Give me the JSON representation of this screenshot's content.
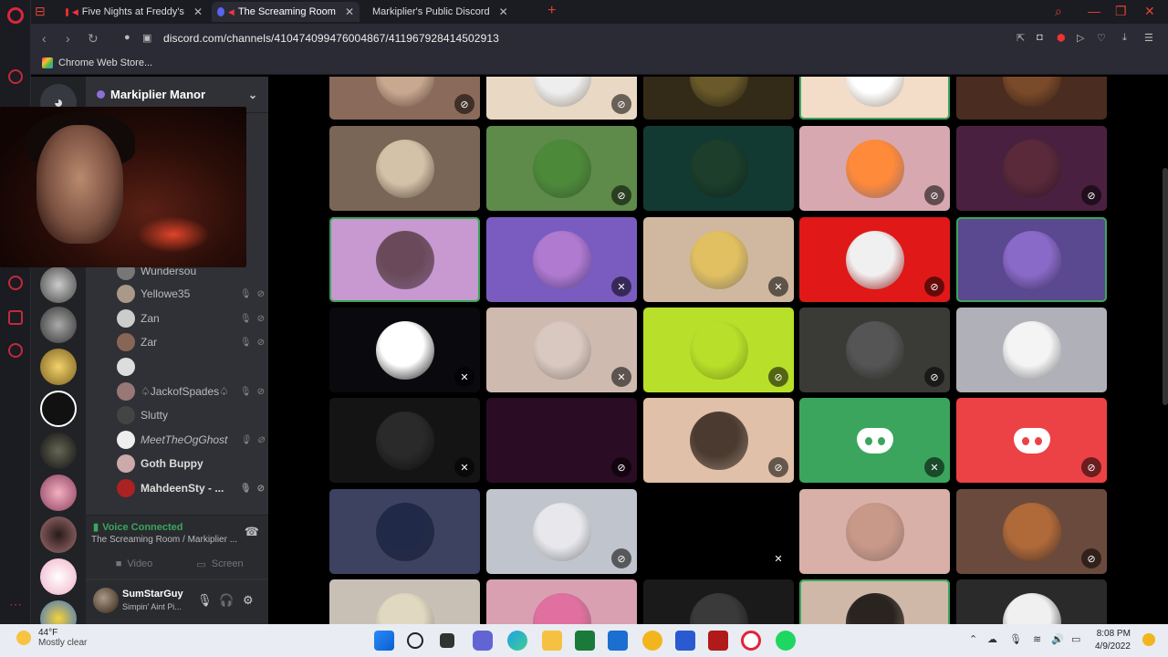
{
  "browser": {
    "tabs": [
      {
        "title": "Five Nights at Freddy's"
      },
      {
        "title": "The Screaming Room",
        "active": true
      },
      {
        "title": "Markiplier's Public Discord"
      }
    ],
    "url": "discord.com/channels/410474099476004867/411967928414502913",
    "bookmark": "Chrome Web Store..."
  },
  "discord": {
    "server_name": "Markiplier Manor",
    "voice_users": [
      {
        "name": "Wundersou"
      },
      {
        "name": "Yellowe35"
      },
      {
        "name": "Zan"
      },
      {
        "name": "Zar"
      },
      {
        "name": ""
      },
      {
        "name": "♤JackofSpades♤"
      },
      {
        "name": "Slutty"
      },
      {
        "name": "MeetTheOgGhost"
      },
      {
        "name": "Goth Buppy"
      },
      {
        "name": "MahdeenSty - ..."
      }
    ],
    "voice_panel": {
      "status": "Voice Connected",
      "channel": "The Screaming Room / Markiplier ...",
      "video_label": "Video",
      "screen_label": "Screen"
    },
    "user": {
      "name": "SumStarGuy",
      "status": "Simpin' Aint Pi..."
    }
  },
  "grid": {
    "tiles": [
      {
        "bg": "#8a6a5a",
        "av": "#c9a890",
        "st": "deaf"
      },
      {
        "bg": "#e8d8c4",
        "av": "#eee",
        "st": "deaf"
      },
      {
        "bg": "#332a18",
        "av": "#6a5a2a",
        "st": ""
      },
      {
        "bg": "#f3dcc8",
        "av": "#fff",
        "st": "",
        "speaking": true
      },
      {
        "bg": "#4a2c20",
        "av": "#7a4a2a",
        "st": ""
      },
      {
        "bg": "#7a6656",
        "av": "#d4c2a8",
        "st": ""
      },
      {
        "bg": "#5e8a4a",
        "av": "#4c8a3a",
        "st": "deaf"
      },
      {
        "bg": "#123a32",
        "av": "#1c3e2a",
        "st": ""
      },
      {
        "bg": "#d8a8b0",
        "av": "#ff8a3a",
        "st": "deaf"
      },
      {
        "bg": "#4a2040",
        "av": "#5a2a3a",
        "st": "deaf"
      },
      {
        "bg": "#c898d0",
        "av": "#6a4a5a",
        "st": "",
        "speaking": true
      },
      {
        "bg": "#7a5cc0",
        "av": "#b07ad0",
        "st": "mute"
      },
      {
        "bg": "#d0b8a0",
        "av": "#e0c060",
        "st": "mute"
      },
      {
        "bg": "#e01818",
        "av": "#f0f0f0",
        "st": "deaf"
      },
      {
        "bg": "#5a4890",
        "av": "#8a6ac8",
        "st": "",
        "speaking": true
      },
      {
        "bg": "#0a0a0e",
        "av": "#ffffff",
        "st": "mute"
      },
      {
        "bg": "#cfbab0",
        "av": "#d8c8c0",
        "st": "mute"
      },
      {
        "bg": "#b8e02a",
        "av": "#b8e02a",
        "st": "deaf"
      },
      {
        "bg": "#3a3a36",
        "av": "#555",
        "st": "deaf"
      },
      {
        "bg": "#b0b0b8",
        "av": "#f4f4f4",
        "st": ""
      },
      {
        "bg": "#141414",
        "av": "#2a2a2a",
        "st": "mute"
      },
      {
        "bg": "#2a0c24",
        "av": "",
        "st": "deaf"
      },
      {
        "bg": "#e0c0a8",
        "av": "#4a3a30",
        "st": "deaf"
      },
      {
        "bg": "#3ba55d",
        "av": "",
        "st": "mute",
        "discord": true
      },
      {
        "bg": "#ed4245",
        "av": "",
        "st": "deaf",
        "discord": true
      },
      {
        "bg": "#3c4260",
        "av": "#202a48",
        "st": ""
      },
      {
        "bg": "#c0c4cc",
        "av": "#e8e8ec",
        "st": "deaf"
      },
      {
        "bg": "#000000",
        "av": "",
        "st": "mute"
      },
      {
        "bg": "#d8b0a8",
        "av": "#c89888",
        "st": ""
      },
      {
        "bg": "#6a4a3c",
        "av": "#b06a3a",
        "st": "deaf"
      },
      {
        "bg": "#c8c0b4",
        "av": "#e0d8c0",
        "st": ""
      },
      {
        "bg": "#d8a0b0",
        "av": "#e070a0",
        "st": ""
      },
      {
        "bg": "#1a1a1a",
        "av": "#3a3a3a",
        "st": ""
      },
      {
        "bg": "#d0b8a8",
        "av": "#2a2420",
        "st": "",
        "speaking": true
      },
      {
        "bg": "#2a2a2a",
        "av": "#f0f0f0",
        "st": ""
      }
    ]
  },
  "taskbar": {
    "temp": "44°F",
    "weather": "Mostly clear",
    "time": "8:08 PM",
    "date": "4/9/2022"
  }
}
